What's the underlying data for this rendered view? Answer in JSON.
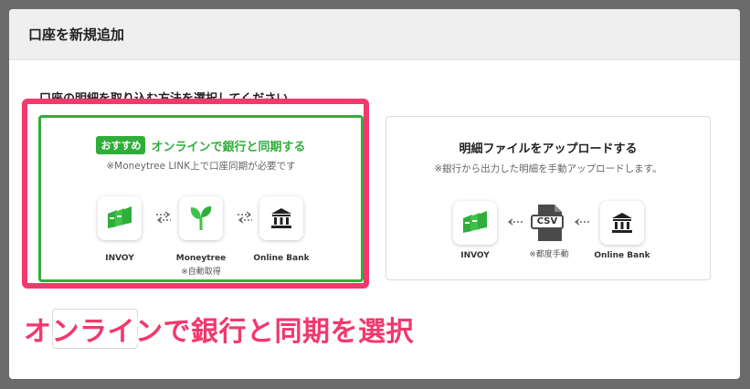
{
  "modal": {
    "title": "口座を新規追加",
    "instruction": "口座の明細を取り込む方法を選択してください。"
  },
  "online_option": {
    "badge": "おすすめ",
    "title": "オンラインで銀行と同期する",
    "subtitle": "※Moneytree LINK上で口座同期が必要です",
    "icons": [
      {
        "name": "invoy-icon",
        "label": "INVOY",
        "note": ""
      },
      {
        "name": "moneytree-icon",
        "label": "Moneytree",
        "note": "※自動取得"
      },
      {
        "name": "bank-icon",
        "label": "Online Bank",
        "note": ""
      }
    ]
  },
  "manual_option": {
    "title": "明細ファイルをアップロードする",
    "subtitle": "※銀行から出力した明細を手動アップロードします。",
    "icons": [
      {
        "name": "invoy-icon",
        "label": "INVOY",
        "note": ""
      },
      {
        "name": "csv-file-icon",
        "label": "",
        "note": "※都度手動"
      },
      {
        "name": "bank-icon",
        "label": "Online Bank",
        "note": ""
      }
    ],
    "csv_text": "CSV"
  },
  "annotation": {
    "caption": "オンラインで銀行と同期を選択"
  },
  "colors": {
    "accent_green": "#2fae3a",
    "highlight_pink": "#f2386d"
  }
}
